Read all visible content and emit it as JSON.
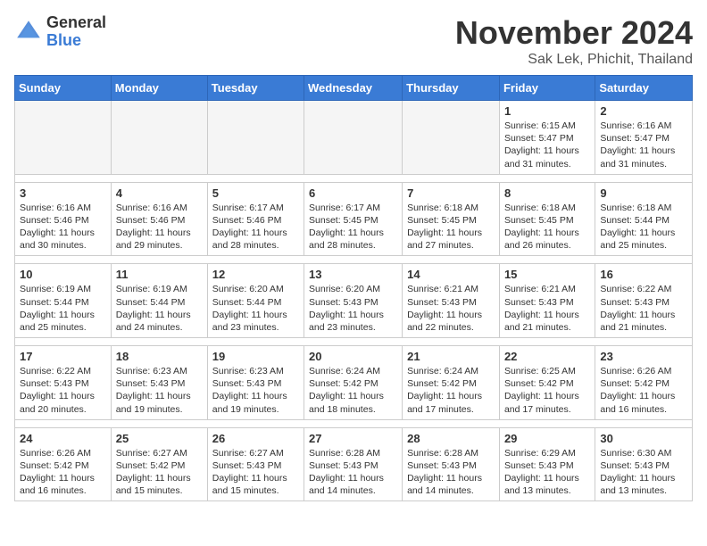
{
  "logo": {
    "general": "General",
    "blue": "Blue"
  },
  "title": "November 2024",
  "location": "Sak Lek, Phichit, Thailand",
  "days_of_week": [
    "Sunday",
    "Monday",
    "Tuesday",
    "Wednesday",
    "Thursday",
    "Friday",
    "Saturday"
  ],
  "weeks": [
    [
      {
        "day": "",
        "info": ""
      },
      {
        "day": "",
        "info": ""
      },
      {
        "day": "",
        "info": ""
      },
      {
        "day": "",
        "info": ""
      },
      {
        "day": "",
        "info": ""
      },
      {
        "day": "1",
        "info": "Sunrise: 6:15 AM\nSunset: 5:47 PM\nDaylight: 11 hours and 31 minutes."
      },
      {
        "day": "2",
        "info": "Sunrise: 6:16 AM\nSunset: 5:47 PM\nDaylight: 11 hours and 31 minutes."
      }
    ],
    [
      {
        "day": "3",
        "info": "Sunrise: 6:16 AM\nSunset: 5:46 PM\nDaylight: 11 hours and 30 minutes."
      },
      {
        "day": "4",
        "info": "Sunrise: 6:16 AM\nSunset: 5:46 PM\nDaylight: 11 hours and 29 minutes."
      },
      {
        "day": "5",
        "info": "Sunrise: 6:17 AM\nSunset: 5:46 PM\nDaylight: 11 hours and 28 minutes."
      },
      {
        "day": "6",
        "info": "Sunrise: 6:17 AM\nSunset: 5:45 PM\nDaylight: 11 hours and 28 minutes."
      },
      {
        "day": "7",
        "info": "Sunrise: 6:18 AM\nSunset: 5:45 PM\nDaylight: 11 hours and 27 minutes."
      },
      {
        "day": "8",
        "info": "Sunrise: 6:18 AM\nSunset: 5:45 PM\nDaylight: 11 hours and 26 minutes."
      },
      {
        "day": "9",
        "info": "Sunrise: 6:18 AM\nSunset: 5:44 PM\nDaylight: 11 hours and 25 minutes."
      }
    ],
    [
      {
        "day": "10",
        "info": "Sunrise: 6:19 AM\nSunset: 5:44 PM\nDaylight: 11 hours and 25 minutes."
      },
      {
        "day": "11",
        "info": "Sunrise: 6:19 AM\nSunset: 5:44 PM\nDaylight: 11 hours and 24 minutes."
      },
      {
        "day": "12",
        "info": "Sunrise: 6:20 AM\nSunset: 5:44 PM\nDaylight: 11 hours and 23 minutes."
      },
      {
        "day": "13",
        "info": "Sunrise: 6:20 AM\nSunset: 5:43 PM\nDaylight: 11 hours and 23 minutes."
      },
      {
        "day": "14",
        "info": "Sunrise: 6:21 AM\nSunset: 5:43 PM\nDaylight: 11 hours and 22 minutes."
      },
      {
        "day": "15",
        "info": "Sunrise: 6:21 AM\nSunset: 5:43 PM\nDaylight: 11 hours and 21 minutes."
      },
      {
        "day": "16",
        "info": "Sunrise: 6:22 AM\nSunset: 5:43 PM\nDaylight: 11 hours and 21 minutes."
      }
    ],
    [
      {
        "day": "17",
        "info": "Sunrise: 6:22 AM\nSunset: 5:43 PM\nDaylight: 11 hours and 20 minutes."
      },
      {
        "day": "18",
        "info": "Sunrise: 6:23 AM\nSunset: 5:43 PM\nDaylight: 11 hours and 19 minutes."
      },
      {
        "day": "19",
        "info": "Sunrise: 6:23 AM\nSunset: 5:43 PM\nDaylight: 11 hours and 19 minutes."
      },
      {
        "day": "20",
        "info": "Sunrise: 6:24 AM\nSunset: 5:42 PM\nDaylight: 11 hours and 18 minutes."
      },
      {
        "day": "21",
        "info": "Sunrise: 6:24 AM\nSunset: 5:42 PM\nDaylight: 11 hours and 17 minutes."
      },
      {
        "day": "22",
        "info": "Sunrise: 6:25 AM\nSunset: 5:42 PM\nDaylight: 11 hours and 17 minutes."
      },
      {
        "day": "23",
        "info": "Sunrise: 6:26 AM\nSunset: 5:42 PM\nDaylight: 11 hours and 16 minutes."
      }
    ],
    [
      {
        "day": "24",
        "info": "Sunrise: 6:26 AM\nSunset: 5:42 PM\nDaylight: 11 hours and 16 minutes."
      },
      {
        "day": "25",
        "info": "Sunrise: 6:27 AM\nSunset: 5:42 PM\nDaylight: 11 hours and 15 minutes."
      },
      {
        "day": "26",
        "info": "Sunrise: 6:27 AM\nSunset: 5:43 PM\nDaylight: 11 hours and 15 minutes."
      },
      {
        "day": "27",
        "info": "Sunrise: 6:28 AM\nSunset: 5:43 PM\nDaylight: 11 hours and 14 minutes."
      },
      {
        "day": "28",
        "info": "Sunrise: 6:28 AM\nSunset: 5:43 PM\nDaylight: 11 hours and 14 minutes."
      },
      {
        "day": "29",
        "info": "Sunrise: 6:29 AM\nSunset: 5:43 PM\nDaylight: 11 hours and 13 minutes."
      },
      {
        "day": "30",
        "info": "Sunrise: 6:30 AM\nSunset: 5:43 PM\nDaylight: 11 hours and 13 minutes."
      }
    ]
  ]
}
